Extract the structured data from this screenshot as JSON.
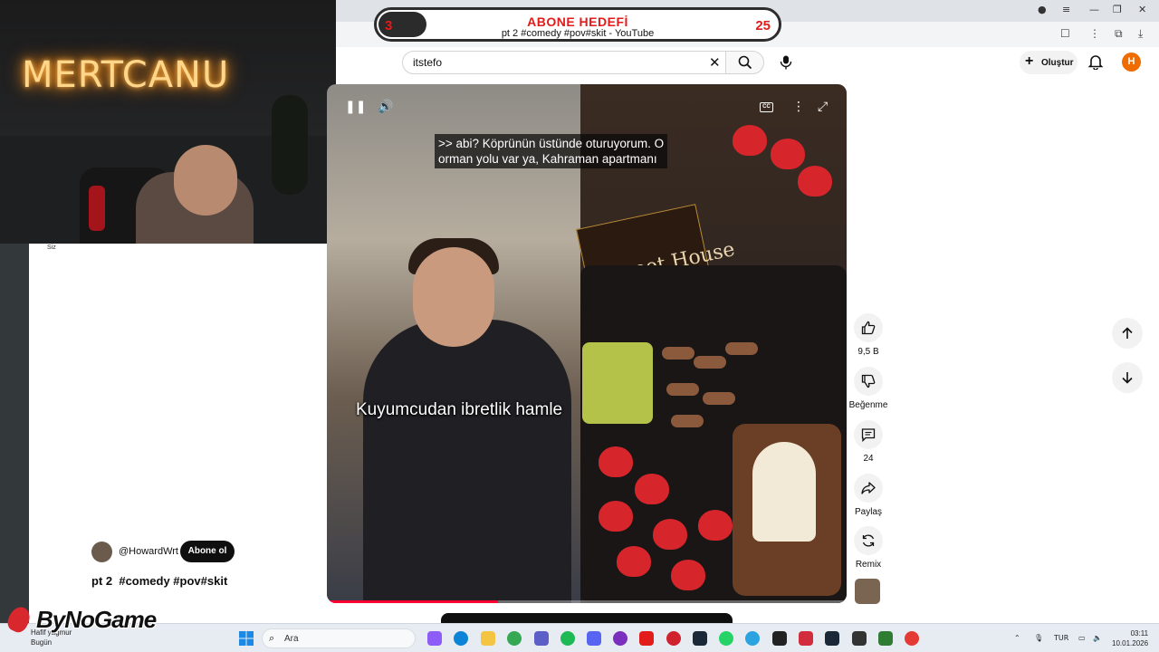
{
  "stream_overlay": {
    "streamer_name": "MERTCANU",
    "goal_title": "ABONE HEDEFİ",
    "goal_current": "3",
    "goal_target": "25",
    "goal_progress_fraction": 0.12,
    "tab_title": "pt 2 #comedy #pov#skit - YouTube",
    "watermark": "ByNoGame"
  },
  "youtube": {
    "search": {
      "value": "itstefo"
    },
    "create_label": "Oluştur",
    "avatar_letter": "H",
    "left_panel": {
      "siz_label": "Siz"
    },
    "video": {
      "caption_lines": ">> abi? Köprünün üstünde oturuyorum. O\norman yolu var ya, Kahraman apartmanı",
      "overlay_text": "Kuyumcudan ibretlik hamle",
      "cafe_sign": "Sweet House",
      "progress_fraction": 0.33
    },
    "channel": {
      "handle": "@HowardWrt",
      "subscribe_label": "Abone ol"
    },
    "title": "pt 2  #comedy #pov#skit",
    "actions": {
      "like_count": "9,5 B",
      "dislike_label": "Beğenme",
      "comment_count": "24",
      "share_label": "Paylaş",
      "remix_label": "Remix"
    }
  },
  "taskbar": {
    "weather_line1": "Hafif yağmur",
    "weather_line2": "Bugün",
    "search_placeholder": "Ara",
    "language": "TUR",
    "time": "03:11",
    "date": "10.01.2026"
  },
  "colors": {
    "accent_red": "#e21b1b",
    "youtube_red": "#ff0033",
    "avatar_orange": "#ef6c00"
  }
}
